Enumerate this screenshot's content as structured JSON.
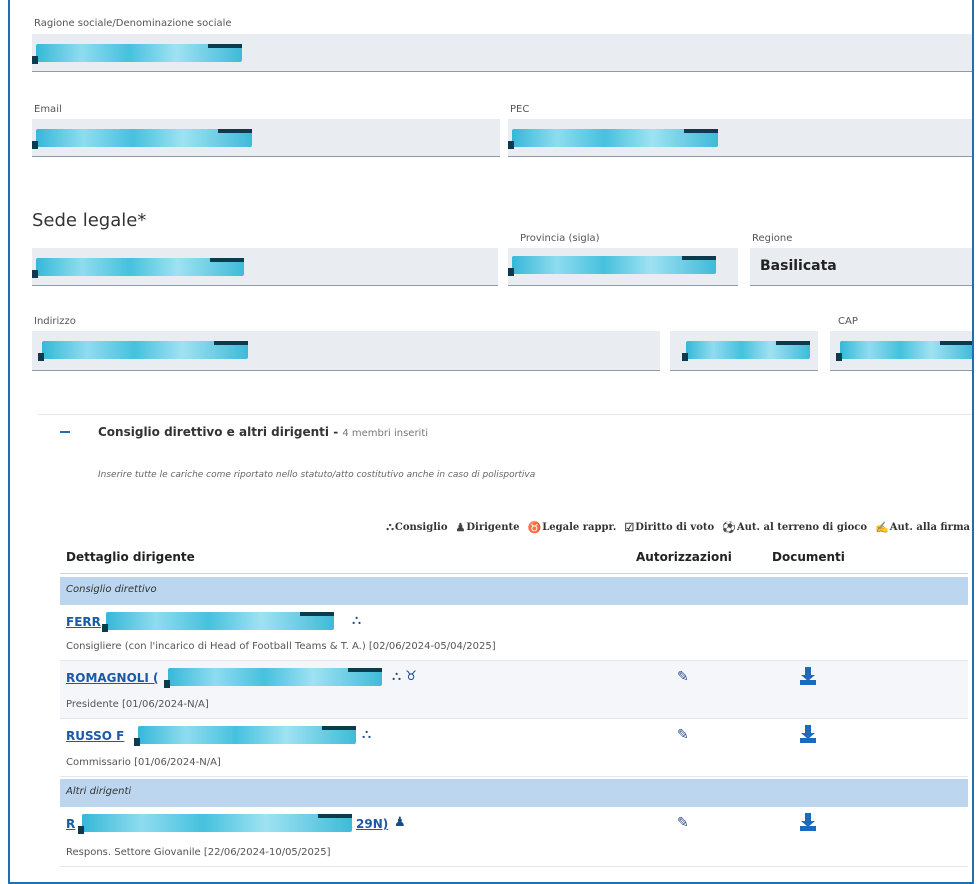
{
  "form": {
    "ragione_label": "Ragione sociale/Denominazione sociale",
    "email_label": "Email",
    "pec_label": "PEC",
    "sede_title": "Sede legale*",
    "provincia_label": "Provincia (sigla)",
    "regione_label": "Regione",
    "regione_value": "Basilicata",
    "indirizzo_label": "Indirizzo",
    "cap_label": "CAP"
  },
  "board": {
    "title": "Consiglio direttivo e altri dirigenti",
    "count": "4 membri inseriti",
    "hint": "Inserire tutte le cariche come riportato nello statuto/atto costitutivo anche in caso di polisportiva",
    "legend": {
      "consiglio": "Consiglio",
      "dirigente": "Dirigente",
      "legale": "Legale rappr.",
      "voto": "Diritto di voto",
      "terreno": "Aut. al terreno di gioco",
      "firma": "Aut. alla firma"
    },
    "columns": {
      "dettaglio": "Dettaglio dirigente",
      "autorizzazioni": "Autorizzazioni",
      "documenti": "Documenti"
    },
    "group1": "Consiglio direttivo",
    "group2": "Altri dirigenti",
    "rows": [
      {
        "name": "FERR",
        "role": "Consigliere (con l'incarico di Head of Football Teams & T. A.) [02/06/2024-05/04/2025]",
        "icons": "⛬"
      },
      {
        "name": "ROMAGNOLI (",
        "role": "Presidente [01/06/2024-N/A]",
        "icons": "⛬ ♉"
      },
      {
        "name": "RUSSO F",
        "role": "Commissario [01/06/2024-N/A]",
        "icons": "⛬"
      },
      {
        "name": "R",
        "name_tail": "29N)",
        "role": "Respons. Settore Giovanile [22/06/2024-10/05/2025]",
        "icons": "♟"
      }
    ]
  },
  "icons": {
    "structure": "⛬",
    "person": "♟",
    "legal": "♉",
    "vote": "☑",
    "field": "⚽",
    "sign": "✍",
    "edit": "✎"
  }
}
